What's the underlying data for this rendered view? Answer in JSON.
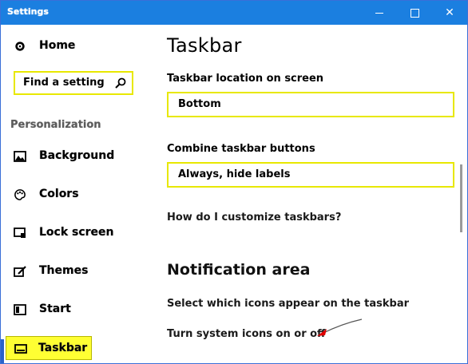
{
  "window": {
    "title": "Settings",
    "controls": {
      "minimize": "minimize",
      "maximize": "maximize",
      "close": "✕"
    }
  },
  "sidebar": {
    "home_label": "Home",
    "search": {
      "placeholder": "Find a setting"
    },
    "section_label": "Personalization",
    "items": [
      {
        "label": "Background",
        "icon": "picture-icon"
      },
      {
        "label": "Colors",
        "icon": "palette-icon"
      },
      {
        "label": "Lock screen",
        "icon": "lock-screen-icon"
      },
      {
        "label": "Themes",
        "icon": "brush-icon"
      },
      {
        "label": "Start",
        "icon": "start-icon"
      },
      {
        "label": "Taskbar",
        "icon": "taskbar-icon",
        "selected": true
      }
    ]
  },
  "main": {
    "title": "Taskbar",
    "location": {
      "label": "Taskbar location on screen",
      "value": "Bottom"
    },
    "combine": {
      "label": "Combine taskbar buttons",
      "value": "Always, hide labels"
    },
    "help_link": "How do I customize taskbars?",
    "notification": {
      "heading": "Notification area",
      "link1": "Select which icons appear on the taskbar",
      "link2": "Turn system icons on or off"
    }
  },
  "colors": {
    "titlebar": "#1b7fe0",
    "highlight": "#ffff33",
    "accent": "#2a63c9"
  }
}
